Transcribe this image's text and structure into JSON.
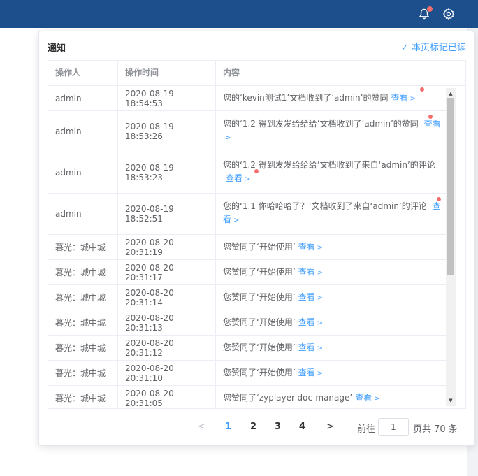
{
  "header": {
    "bell_icon": "bell-icon",
    "gear_icon": "gear-icon",
    "accent": "#1d4f8c"
  },
  "notifications": {
    "title": "通知",
    "mark_all_read": "本页标记已读",
    "columns": [
      "操作人",
      "操作时间",
      "内容"
    ],
    "view_label": "查看",
    "rows": [
      {
        "operator": "admin",
        "time": "2020-08-19 18:54:53",
        "content": "您的‘kevin测试1’文档收到了‘admin’的赞同",
        "unread": true
      },
      {
        "operator": "admin",
        "time": "2020-08-19 18:53:26",
        "content": "您的‘1.2 得到发发给给给’文档收到了‘admin’的赞同",
        "unread": true
      },
      {
        "operator": "admin",
        "time": "2020-08-19 18:53:23",
        "content": "您的‘1.2 得到发发给给给’文档收到了来自‘admin’的评论",
        "unread": true
      },
      {
        "operator": "admin",
        "time": "2020-08-19 18:52:51",
        "content": "您的‘1.1 你哈哈哈了？’文档收到了来自‘admin’的评论",
        "unread": true
      },
      {
        "operator": "暮光：城中城",
        "time": "2020-08-20 20:31:19",
        "content": "您赞同了‘开始使用’",
        "unread": false
      },
      {
        "operator": "暮光：城中城",
        "time": "2020-08-20 20:31:17",
        "content": "您赞同了‘开始使用’",
        "unread": false
      },
      {
        "operator": "暮光：城中城",
        "time": "2020-08-20 20:31:14",
        "content": "您赞同了‘开始使用’",
        "unread": false
      },
      {
        "operator": "暮光：城中城",
        "time": "2020-08-20 20:31:13",
        "content": "您赞同了‘开始使用’",
        "unread": false
      },
      {
        "operator": "暮光：城中城",
        "time": "2020-08-20 20:31:12",
        "content": "您赞同了‘开始使用’",
        "unread": false
      },
      {
        "operator": "暮光：城中城",
        "time": "2020-08-20 20:31:10",
        "content": "您赞同了‘开始使用’",
        "unread": false
      },
      {
        "operator": "暮光：城中城",
        "time": "2020-08-20 20:31:05",
        "content": "您赞同了‘zyplayer-doc-manage’",
        "unread": false
      }
    ]
  },
  "pagination": {
    "pages": [
      "1",
      "2",
      "3",
      "4"
    ],
    "current": "1",
    "goto_label": "前往",
    "goto_value": "1",
    "total_label": "页共 70 条"
  }
}
